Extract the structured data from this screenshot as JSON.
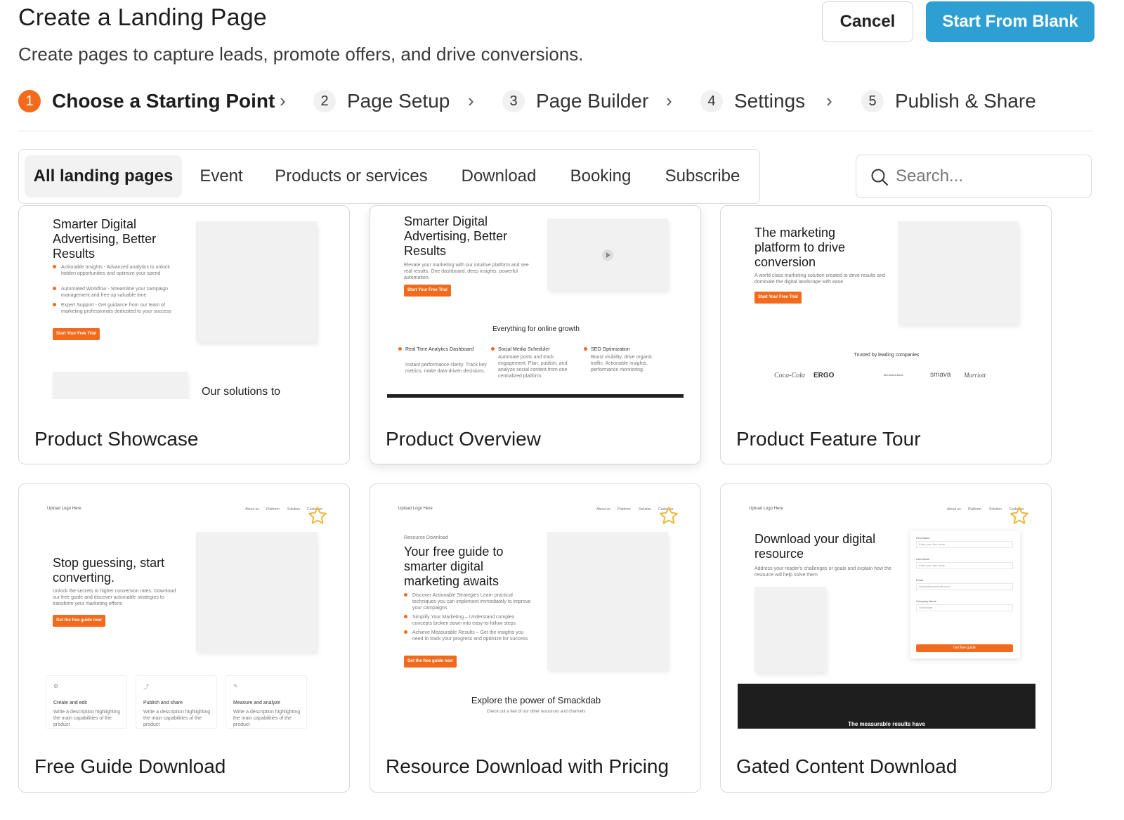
{
  "header": {
    "title": "Create a Landing Page",
    "subtitle": "Create pages to capture leads, promote offers, and drive conversions.",
    "cancel_label": "Cancel",
    "start_blank_label": "Start From Blank"
  },
  "steps": [
    {
      "num": "1",
      "label": "Choose a Starting Point"
    },
    {
      "num": "2",
      "label": "Page Setup"
    },
    {
      "num": "3",
      "label": "Page Builder"
    },
    {
      "num": "4",
      "label": "Settings"
    },
    {
      "num": "5",
      "label": "Publish & Share"
    }
  ],
  "filters": [
    "All landing pages",
    "Event",
    "Products or services",
    "Download",
    "Booking",
    "Subscribe"
  ],
  "search": {
    "placeholder": "Search..."
  },
  "colors": {
    "accent": "#f26b1d",
    "primary": "#2e9fd3"
  },
  "cards": [
    {
      "title": "Product Showcase",
      "preview": {
        "headline": "Smarter Digital Advertising, Better Results",
        "bullets": [
          "Actionable Insights - Advanced analytics to unlock hidden opportunities and optimize your spend",
          "Automated Workflow - Streamline your campaign management and free up valuable time",
          "Expert Support - Get guidance from our team of marketing professionals dedicated to your success"
        ],
        "cta": "Start Your Free Trial",
        "section": "Our solutions to"
      }
    },
    {
      "title": "Product Overview",
      "preview": {
        "headline": "Smarter Digital Advertising, Better Results",
        "body": "Elevate your marketing with our intuitive platform and see real results. One dashboard, deep insights, powerful automation.",
        "cta": "Start Your Free Trial",
        "section": "Everything for online growth",
        "features": [
          {
            "title": "Real Time Analytics Dashboard",
            "desc": "Instant performance clarity. Track key metrics, make data-driven decisions."
          },
          {
            "title": "Social Media Scheduler",
            "desc": "Automate posts and track engagement. Plan, publish, and analyze social content from one centralized platform."
          },
          {
            "title": "SEO Optimization",
            "desc": "Boost visibility, drive organic traffic. Actionable insights, performance monitoring."
          }
        ]
      }
    },
    {
      "title": "Product Feature Tour",
      "preview": {
        "headline": "The marketing platform to drive conversion",
        "body": "A world class marketing solution created to drive results and dominate the digital landscape with ease",
        "cta": "Start Your Free Trial",
        "trusted": "Trusted by leading companies",
        "logos": [
          "Coca-Cola",
          "ERGO",
          "Mercedes-Benz",
          "smava",
          "Marriott"
        ]
      }
    },
    {
      "title": "Free Guide Download",
      "preview": {
        "logo": "Upload Logo Here",
        "nav": [
          "About us",
          "Platform",
          "Solution",
          "Customer"
        ],
        "headline": "Stop guessing, start converting.",
        "body": "Unlock the secrets to higher conversion rates. Download our free guide and discover actionable strategies to transform your marketing efforts",
        "cta": "Get the free guide now",
        "features": [
          {
            "title": "Create and edit",
            "desc": "Write a description highlighting the main capabilities of the product"
          },
          {
            "title": "Publish and share",
            "desc": "Write a description highlighting the main capabilities of the product"
          },
          {
            "title": "Measure and analyze",
            "desc": "Write a description highlighting the main capabilities of the product"
          }
        ]
      }
    },
    {
      "title": "Resource Download with Pricing",
      "preview": {
        "logo": "Upload Logo Here",
        "nav": [
          "About us",
          "Platform",
          "Solution",
          "Customer"
        ],
        "eyebrow": "Resource Download",
        "headline": "Your free guide to smarter digital marketing awaits",
        "bullets": [
          "Discover Actionable Strategies Learn practical techniques you can implement immediately to improve your campaigns",
          "Simplify Your Marketing – Understand complex concepts broken down into easy-to-follow steps",
          "Achieve Measurable Results – Get the insights you need to track your progress and optimize for success"
        ],
        "cta": "Get the free guide now",
        "section": "Explore the power of Smackdab",
        "section_sub": "Check out a few of our other resources and channels"
      }
    },
    {
      "title": "Gated Content Download",
      "preview": {
        "logo": "Upload Logo Here",
        "nav": [
          "About us",
          "Platform",
          "Solution",
          "Customer"
        ],
        "headline": "Download your digital resource",
        "body": "Address your reader's challenges or goals and explain how the resource will help solve them",
        "form": [
          {
            "label": "First Name",
            "placeholder": "Enter your first name"
          },
          {
            "label": "Last Name",
            "placeholder": "Enter your last name"
          },
          {
            "label": "Email",
            "placeholder": "sample@smackdab.com"
          },
          {
            "label": "Company Name",
            "placeholder": "Smackdab"
          }
        ],
        "cta": "Get free guide",
        "footer": "The measurable results have"
      }
    }
  ]
}
